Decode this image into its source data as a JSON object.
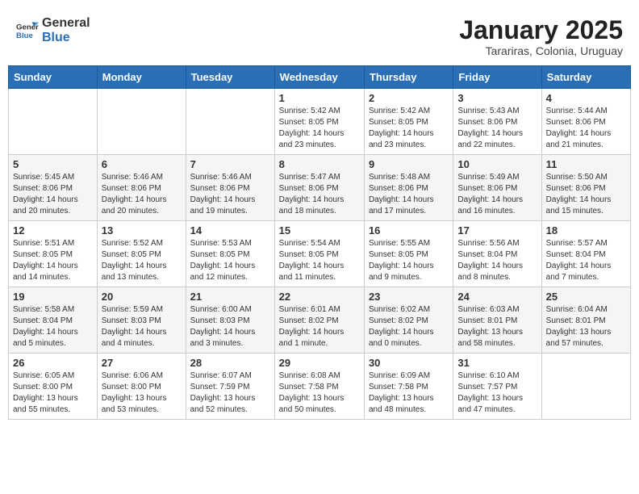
{
  "header": {
    "logo_general": "General",
    "logo_blue": "Blue",
    "month_title": "January 2025",
    "location": "Tarariras, Colonia, Uruguay"
  },
  "weekdays": [
    "Sunday",
    "Monday",
    "Tuesday",
    "Wednesday",
    "Thursday",
    "Friday",
    "Saturday"
  ],
  "weeks": [
    [
      {
        "day": "",
        "info": ""
      },
      {
        "day": "",
        "info": ""
      },
      {
        "day": "",
        "info": ""
      },
      {
        "day": "1",
        "info": "Sunrise: 5:42 AM\nSunset: 8:05 PM\nDaylight: 14 hours\nand 23 minutes."
      },
      {
        "day": "2",
        "info": "Sunrise: 5:42 AM\nSunset: 8:05 PM\nDaylight: 14 hours\nand 23 minutes."
      },
      {
        "day": "3",
        "info": "Sunrise: 5:43 AM\nSunset: 8:06 PM\nDaylight: 14 hours\nand 22 minutes."
      },
      {
        "day": "4",
        "info": "Sunrise: 5:44 AM\nSunset: 8:06 PM\nDaylight: 14 hours\nand 21 minutes."
      }
    ],
    [
      {
        "day": "5",
        "info": "Sunrise: 5:45 AM\nSunset: 8:06 PM\nDaylight: 14 hours\nand 20 minutes."
      },
      {
        "day": "6",
        "info": "Sunrise: 5:46 AM\nSunset: 8:06 PM\nDaylight: 14 hours\nand 20 minutes."
      },
      {
        "day": "7",
        "info": "Sunrise: 5:46 AM\nSunset: 8:06 PM\nDaylight: 14 hours\nand 19 minutes."
      },
      {
        "day": "8",
        "info": "Sunrise: 5:47 AM\nSunset: 8:06 PM\nDaylight: 14 hours\nand 18 minutes."
      },
      {
        "day": "9",
        "info": "Sunrise: 5:48 AM\nSunset: 8:06 PM\nDaylight: 14 hours\nand 17 minutes."
      },
      {
        "day": "10",
        "info": "Sunrise: 5:49 AM\nSunset: 8:06 PM\nDaylight: 14 hours\nand 16 minutes."
      },
      {
        "day": "11",
        "info": "Sunrise: 5:50 AM\nSunset: 8:06 PM\nDaylight: 14 hours\nand 15 minutes."
      }
    ],
    [
      {
        "day": "12",
        "info": "Sunrise: 5:51 AM\nSunset: 8:05 PM\nDaylight: 14 hours\nand 14 minutes."
      },
      {
        "day": "13",
        "info": "Sunrise: 5:52 AM\nSunset: 8:05 PM\nDaylight: 14 hours\nand 13 minutes."
      },
      {
        "day": "14",
        "info": "Sunrise: 5:53 AM\nSunset: 8:05 PM\nDaylight: 14 hours\nand 12 minutes."
      },
      {
        "day": "15",
        "info": "Sunrise: 5:54 AM\nSunset: 8:05 PM\nDaylight: 14 hours\nand 11 minutes."
      },
      {
        "day": "16",
        "info": "Sunrise: 5:55 AM\nSunset: 8:05 PM\nDaylight: 14 hours\nand 9 minutes."
      },
      {
        "day": "17",
        "info": "Sunrise: 5:56 AM\nSunset: 8:04 PM\nDaylight: 14 hours\nand 8 minutes."
      },
      {
        "day": "18",
        "info": "Sunrise: 5:57 AM\nSunset: 8:04 PM\nDaylight: 14 hours\nand 7 minutes."
      }
    ],
    [
      {
        "day": "19",
        "info": "Sunrise: 5:58 AM\nSunset: 8:04 PM\nDaylight: 14 hours\nand 5 minutes."
      },
      {
        "day": "20",
        "info": "Sunrise: 5:59 AM\nSunset: 8:03 PM\nDaylight: 14 hours\nand 4 minutes."
      },
      {
        "day": "21",
        "info": "Sunrise: 6:00 AM\nSunset: 8:03 PM\nDaylight: 14 hours\nand 3 minutes."
      },
      {
        "day": "22",
        "info": "Sunrise: 6:01 AM\nSunset: 8:02 PM\nDaylight: 14 hours\nand 1 minute."
      },
      {
        "day": "23",
        "info": "Sunrise: 6:02 AM\nSunset: 8:02 PM\nDaylight: 14 hours\nand 0 minutes."
      },
      {
        "day": "24",
        "info": "Sunrise: 6:03 AM\nSunset: 8:01 PM\nDaylight: 13 hours\nand 58 minutes."
      },
      {
        "day": "25",
        "info": "Sunrise: 6:04 AM\nSunset: 8:01 PM\nDaylight: 13 hours\nand 57 minutes."
      }
    ],
    [
      {
        "day": "26",
        "info": "Sunrise: 6:05 AM\nSunset: 8:00 PM\nDaylight: 13 hours\nand 55 minutes."
      },
      {
        "day": "27",
        "info": "Sunrise: 6:06 AM\nSunset: 8:00 PM\nDaylight: 13 hours\nand 53 minutes."
      },
      {
        "day": "28",
        "info": "Sunrise: 6:07 AM\nSunset: 7:59 PM\nDaylight: 13 hours\nand 52 minutes."
      },
      {
        "day": "29",
        "info": "Sunrise: 6:08 AM\nSunset: 7:58 PM\nDaylight: 13 hours\nand 50 minutes."
      },
      {
        "day": "30",
        "info": "Sunrise: 6:09 AM\nSunset: 7:58 PM\nDaylight: 13 hours\nand 48 minutes."
      },
      {
        "day": "31",
        "info": "Sunrise: 6:10 AM\nSunset: 7:57 PM\nDaylight: 13 hours\nand 47 minutes."
      },
      {
        "day": "",
        "info": ""
      }
    ]
  ]
}
